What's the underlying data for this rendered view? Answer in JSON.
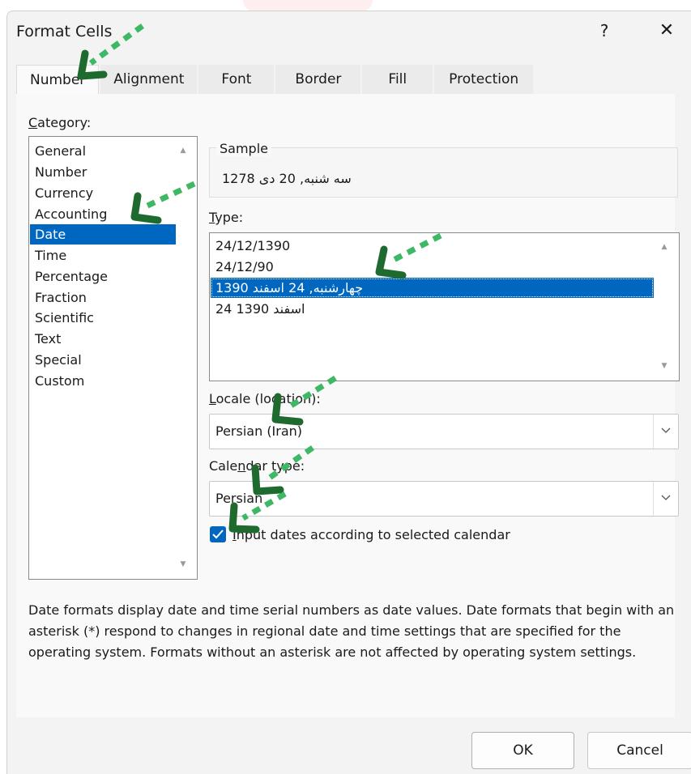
{
  "window": {
    "title": "Format Cells",
    "help_glyph": "?",
    "close_glyph": "✕"
  },
  "tabs": [
    {
      "label": "Number",
      "active": true
    },
    {
      "label": "Alignment",
      "active": false
    },
    {
      "label": "Font",
      "active": false
    },
    {
      "label": "Border",
      "active": false
    },
    {
      "label": "Fill",
      "active": false
    },
    {
      "label": "Protection",
      "active": false
    }
  ],
  "category": {
    "label_access": "C",
    "label_rest": "ategory:",
    "items": [
      "General",
      "Number",
      "Currency",
      "Accounting",
      "Date",
      "Time",
      "Percentage",
      "Fraction",
      "Scientific",
      "Text",
      "Special",
      "Custom"
    ],
    "selected": "Date"
  },
  "sample": {
    "label": "Sample",
    "value": "سه شنبه, 20 دی 1278"
  },
  "type": {
    "label_access": "T",
    "label_rest": "ype:",
    "items": [
      "24/12/1390",
      "24/12/90",
      "چهارشنبه, 24 اسفند 1390",
      "24 اسفند 1390"
    ],
    "selected": "چهارشنبه, 24 اسفند 1390"
  },
  "locale": {
    "label_access": "L",
    "label_rest": "ocale (location):",
    "value": "Persian (Iran)"
  },
  "calendar": {
    "label_pre": "Cale",
    "label_access": "n",
    "label_rest": "dar type:",
    "value": "Persian"
  },
  "checkbox": {
    "checked": true,
    "label_access": "I",
    "label_rest": "nput dates according to selected calendar"
  },
  "description": "Date formats display date and time serial numbers as date values.  Date formats that begin with an asterisk (*) respond to changes in regional date and time settings that are specified for the operating system. Formats without an asterisk are not affected by operating system settings.",
  "buttons": {
    "ok": "OK",
    "cancel": "Cancel"
  },
  "colors": {
    "accent": "#0067c0",
    "annotation_arrow": "#1f6b2f",
    "annotation_dash": "#3fb865"
  }
}
